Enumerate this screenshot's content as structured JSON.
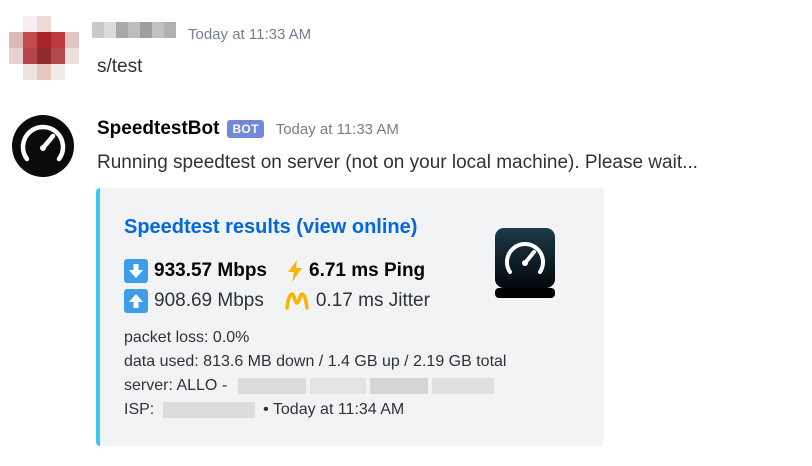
{
  "message1": {
    "timestamp": "Today at 11:33 AM",
    "text": "s/test"
  },
  "message2": {
    "username": "SpeedtestBot",
    "badge": "BOT",
    "timestamp": "Today at 11:33 AM",
    "text": "Running speedtest on server (not on your local machine). Please wait..."
  },
  "embed": {
    "title": "Speedtest results (view online)",
    "download": "933.57 Mbps",
    "ping": "6.71 ms Ping",
    "upload": "908.69 Mbps",
    "jitter": "0.17 ms Jitter",
    "packet_loss": "packet loss: 0.0%",
    "data_used": "data used: 813.6 MB down / 1.4 GB up / 2.19 GB total",
    "server_label": "server: ALLO -",
    "isp_label": "ISP:",
    "footer_timestamp": "• Today at 11:34 AM",
    "accent_color": "#38c9f1",
    "title_color": "#0068e0"
  },
  "icons": {
    "download": "down-arrow-icon",
    "upload": "up-arrow-icon",
    "ping": "lightning-icon",
    "jitter": "jitter-icon",
    "logo": "speedometer-icon"
  }
}
